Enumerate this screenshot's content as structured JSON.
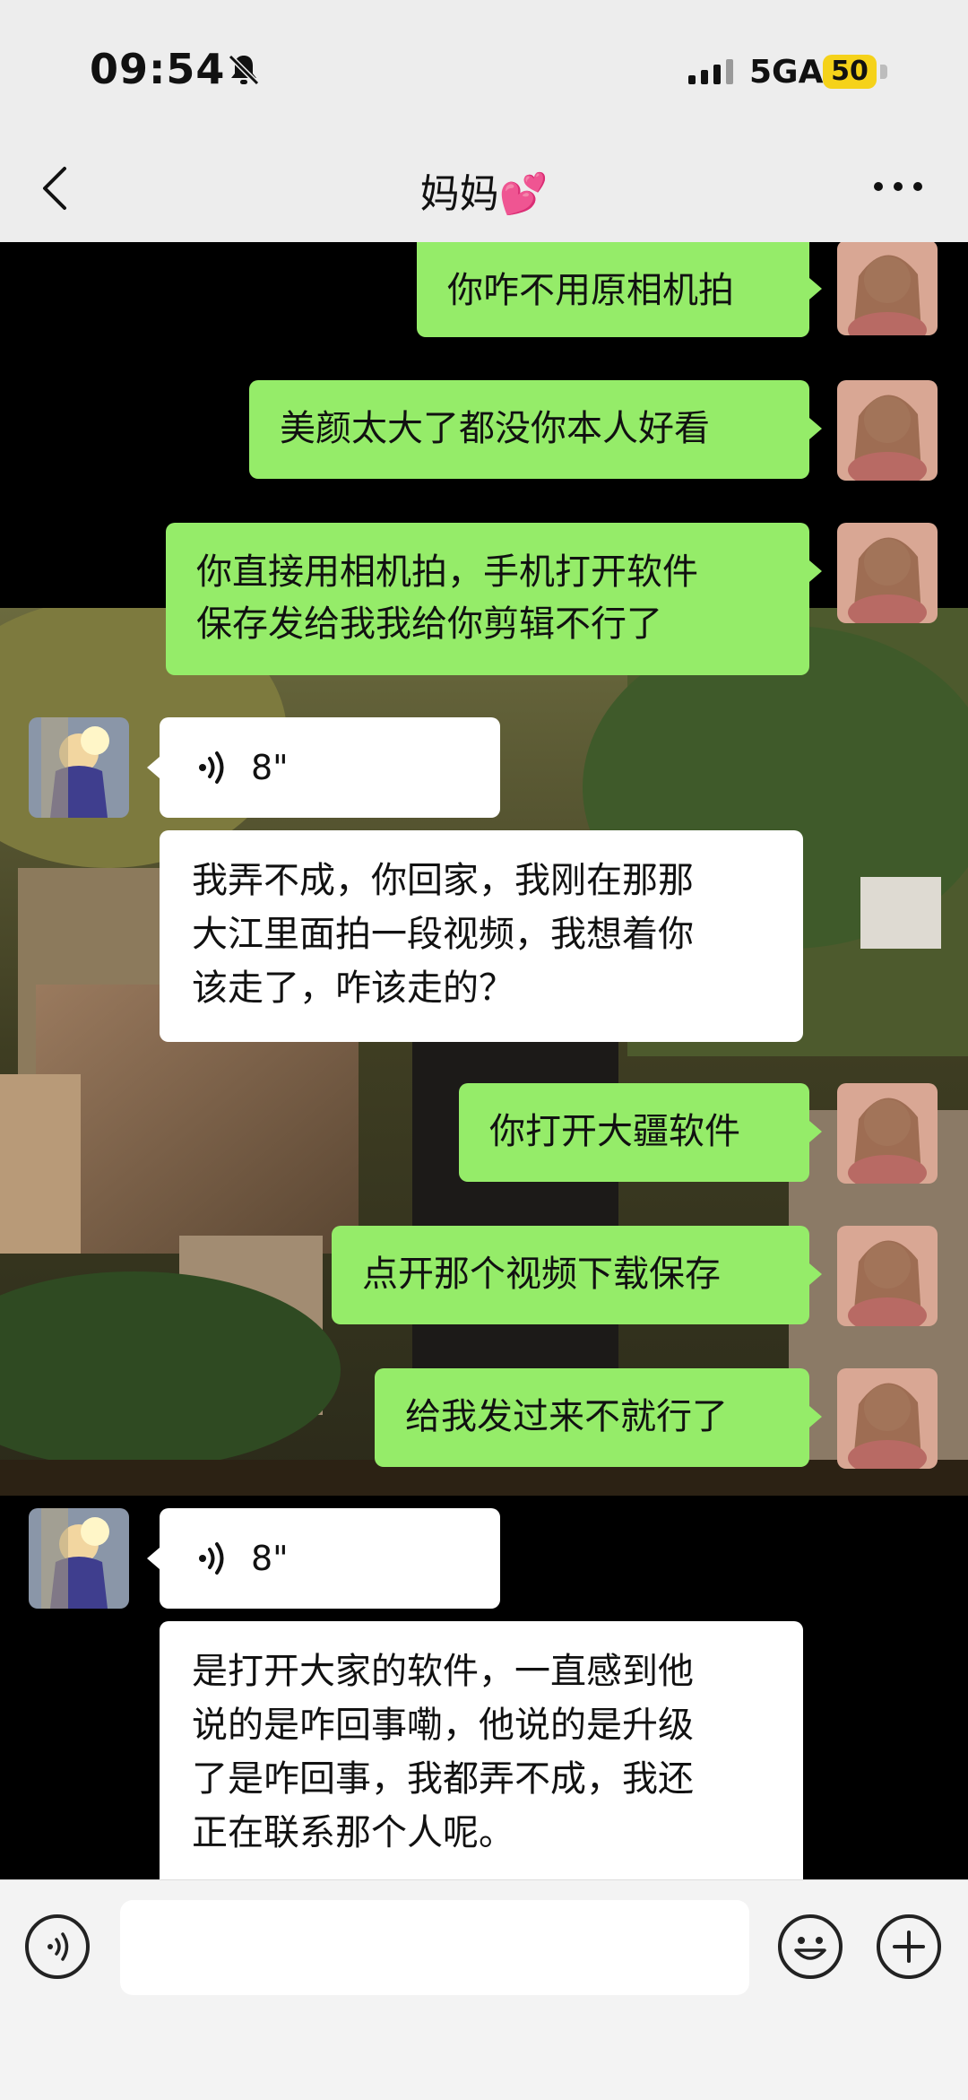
{
  "status_bar": {
    "time": "09:54",
    "network": "5GA",
    "battery": "50",
    "icons": [
      "bell-muted-icon",
      "signal-icon"
    ]
  },
  "header": {
    "title": "妈妈💕",
    "icons": [
      "back-chevron-icon",
      "more-dots-icon"
    ]
  },
  "messages": [
    {
      "from": "me",
      "text": "你咋不用原相机拍"
    },
    {
      "from": "me",
      "text": "美颜太大了都没你本人好看"
    },
    {
      "from": "me",
      "lines": [
        "你直接用相机拍，手机打开软件",
        "保存发给我我给你剪辑不行了"
      ]
    },
    {
      "from": "mom",
      "type": "voice",
      "duration": "8\""
    },
    {
      "from": "mom",
      "lines": [
        "我弄不成，你回家，我刚在那那",
        "大江里面拍一段视频，我想着你",
        "该走了，咋该走的？"
      ]
    },
    {
      "from": "me",
      "text": "你打开大疆软件"
    },
    {
      "from": "me",
      "text": "点开那个视频下载保存"
    },
    {
      "from": "me",
      "text": "给我发过来不就行了"
    },
    {
      "from": "mom",
      "type": "voice",
      "duration": "8\""
    },
    {
      "from": "mom",
      "lines": [
        "是打开大家的软件，一直感到他",
        "说的是咋回事嘞，他说的是升级",
        "了是咋回事，我都弄不成，我还",
        "正在联系那个人呢。"
      ]
    }
  ],
  "input_bar": {
    "icons": [
      "voice-input-icon",
      "emoji-icon",
      "add-plus-icon"
    ]
  },
  "colors": {
    "my_bubble": "#95ec69",
    "their_bubble": "#ffffff",
    "bar_background": "#ededed",
    "battery": "#f5d21a"
  }
}
